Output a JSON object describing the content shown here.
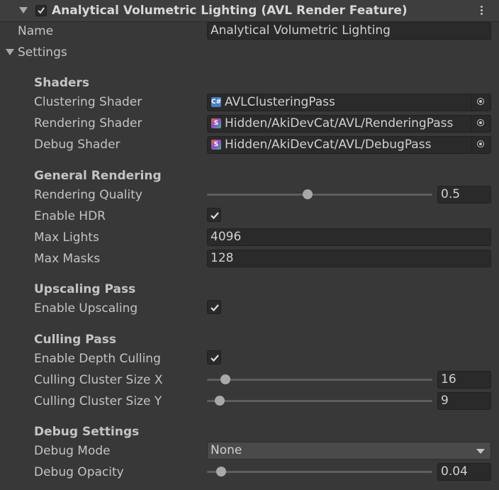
{
  "header": {
    "title": "Analytical Volumetric Lighting (AVL Render Feature)",
    "enabled": true
  },
  "name": {
    "label": "Name",
    "value": "Analytical Volumetric Lighting"
  },
  "settings": {
    "label": "Settings"
  },
  "shaders": {
    "heading": "Shaders",
    "clustering": {
      "label": "Clustering Shader",
      "value": "AVLClusteringPass",
      "icon": "csharp-script-icon"
    },
    "rendering": {
      "label": "Rendering Shader",
      "value": "Hidden/AkiDevCat/AVL/RenderingPass",
      "icon": "shader-icon"
    },
    "debug": {
      "label": "Debug Shader",
      "value": "Hidden/AkiDevCat/AVL/DebugPass",
      "icon": "shader-icon"
    }
  },
  "general": {
    "heading": "General Rendering",
    "quality": {
      "label": "Rendering Quality",
      "value": "0.5",
      "fraction": 0.5
    },
    "hdr": {
      "label": "Enable HDR",
      "checked": true
    },
    "max_lights": {
      "label": "Max Lights",
      "value": "4096"
    },
    "max_masks": {
      "label": "Max Masks",
      "value": "128"
    }
  },
  "upscaling": {
    "heading": "Upscaling Pass",
    "enable": {
      "label": "Enable Upscaling",
      "checked": true
    }
  },
  "culling": {
    "heading": "Culling Pass",
    "depth": {
      "label": "Enable Depth Culling",
      "checked": true
    },
    "size_x": {
      "label": "Culling Cluster Size X",
      "value": "16",
      "fraction": 0.08
    },
    "size_y": {
      "label": "Culling Cluster Size Y",
      "value": "9",
      "fraction": 0.05
    }
  },
  "debug": {
    "heading": "Debug Settings",
    "mode": {
      "label": "Debug Mode",
      "value": "None"
    },
    "opacity": {
      "label": "Debug Opacity",
      "value": "0.04",
      "fraction": 0.06
    }
  }
}
